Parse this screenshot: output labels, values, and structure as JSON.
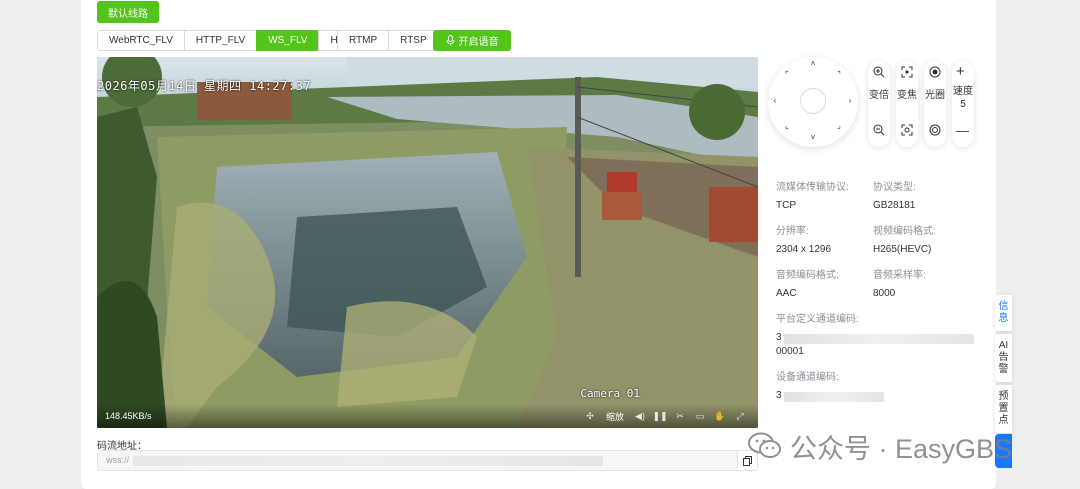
{
  "toolbar": {
    "default_line": "默认线路",
    "tabs": [
      {
        "label": "WebRTC_FLV",
        "active": false
      },
      {
        "label": "HTTP_FLV",
        "active": false
      },
      {
        "label": "WS_FLV",
        "active": true
      },
      {
        "label": "HLS",
        "active": false
      }
    ],
    "tabs2": [
      {
        "label": "RTMP",
        "active": false
      },
      {
        "label": "RTSP",
        "active": false
      }
    ],
    "voice_btn": "开启语音"
  },
  "video": {
    "osd_time": "2026年05月14日 星期四 14:27:37",
    "osd_camera": "Camera 01",
    "bitrate": "148.45KB/s",
    "zoom_label": "缩放"
  },
  "stream": {
    "label": "码流地址：",
    "prefix": "wss://"
  },
  "ptz": {
    "zoom": "变倍",
    "focus": "变焦",
    "iris": "光圈",
    "speed_label": "速度",
    "speed_value": "5"
  },
  "info": {
    "transport_label": "流媒体传输协议:",
    "transport_value": "TCP",
    "protocol_label": "协议类型:",
    "protocol_value": "GB28181",
    "resolution_label": "分辨率:",
    "resolution_value": "2304 x 1296",
    "video_codec_label": "视频编码格式:",
    "video_codec_value": "H265(HEVC)",
    "audio_codec_label": "音频编码格式:",
    "audio_codec_value": "AAC",
    "sample_rate_label": "音频采样率:",
    "sample_rate_value": "8000",
    "platform_channel_label": "平台定义通道编码:",
    "platform_channel_prefix": "3",
    "platform_channel_suffix": "00001",
    "device_channel_label": "设备通道编码:",
    "device_channel_prefix": "3"
  },
  "side_tabs": {
    "info": "信息",
    "ai_alarm": "AI告警",
    "preset": "预置点"
  },
  "watermark": {
    "text": "公众号 · EasyGBS"
  },
  "colors": {
    "accent_green": "#52c41a",
    "accent_blue": "#1677ff"
  }
}
